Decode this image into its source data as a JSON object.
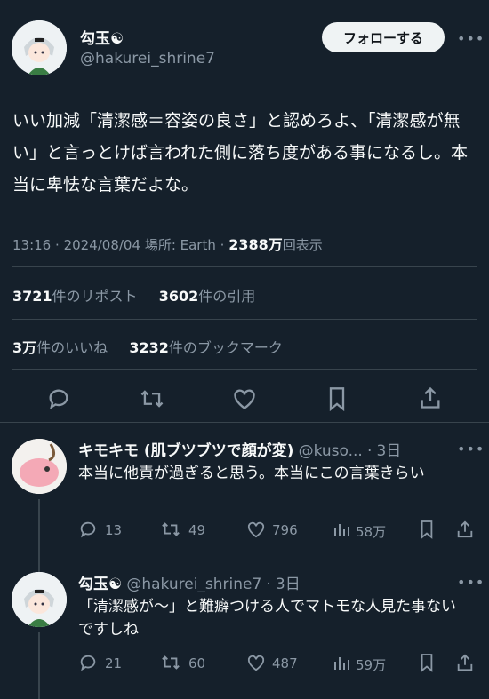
{
  "tweet": {
    "author_name": "勾玉☯",
    "author_handle": "@hakurei_shrine7",
    "follow_label": "フォローする",
    "more": "•••",
    "text": "いい加減「清潔感＝容姿の良さ」と認めろよ、「清潔感が無い」と言っとけば言われた側に落ち度がある事になるし。本当に卑怯な言葉だよな。",
    "time": "13:16",
    "date": "2024/08/04",
    "place_label": "場所: Earth",
    "views_count": "2388万",
    "views_label": "回表示",
    "reposts_count": "3721",
    "reposts_label": "件のリポスト",
    "quotes_count": "3602",
    "quotes_label": "件の引用",
    "likes_count": "3万",
    "likes_label": "件のいいね",
    "bookmarks_count": "3232",
    "bookmarks_label": "件のブックマーク"
  },
  "replies": [
    {
      "name": "キモキモ (肌ブツブツで顔が変)",
      "handle": "@kuso...",
      "time": "3日",
      "text": "本当に他責が過ぎると思う。本当にこの言葉きらい",
      "replies": "13",
      "reposts": "49",
      "likes": "796",
      "views": "58万"
    },
    {
      "name": "勾玉☯",
      "handle": "@hakurei_shrine7",
      "time": "3日",
      "text": "「清潔感が〜」と難癖つける人でマトモな人見た事ないですしね",
      "replies": "21",
      "reposts": "60",
      "likes": "487",
      "views": "59万"
    }
  ],
  "icons": [
    "reply-icon",
    "repost-icon",
    "like-icon",
    "bookmark-icon",
    "share-icon",
    "views-icon"
  ],
  "colors": {
    "background": "#15202b",
    "text": "#f7f9f9",
    "muted": "#8b98a5",
    "divider": "#38444d"
  }
}
